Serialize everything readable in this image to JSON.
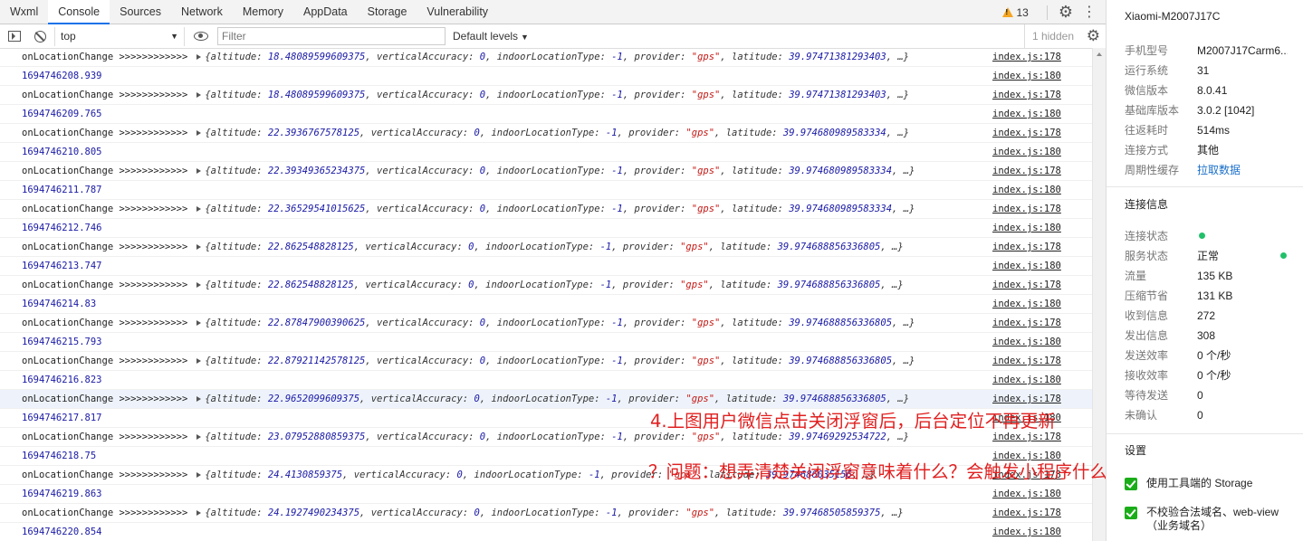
{
  "tabs": [
    "Wxml",
    "Console",
    "Sources",
    "Network",
    "Memory",
    "AppData",
    "Storage",
    "Vulnerability"
  ],
  "active_tab": "Console",
  "warnings_count": "13",
  "toolbar": {
    "context": "top",
    "filter_placeholder": "Filter",
    "levels": "Default levels",
    "hidden": "1 hidden"
  },
  "logs": [
    {
      "label": "onLocationChange >>>>>>>>>>>>",
      "altitude": "18.48089599609375",
      "latitude": "39.97471381293403",
      "src": "index.js:178",
      "ts": "1694746208.939",
      "ts_src": "index.js:180"
    },
    {
      "label": "onLocationChange >>>>>>>>>>>>",
      "altitude": "18.48089599609375",
      "latitude": "39.97471381293403",
      "src": "index.js:178",
      "ts": "1694746209.765",
      "ts_src": "index.js:180"
    },
    {
      "label": "onLocationChange >>>>>>>>>>>>",
      "altitude": "22.3936767578125",
      "latitude": "39.974680989583334",
      "src": "index.js:178",
      "ts": "1694746210.805",
      "ts_src": "index.js:180"
    },
    {
      "label": "onLocationChange >>>>>>>>>>>>",
      "altitude": "22.39349365234375",
      "latitude": "39.974680989583334",
      "src": "index.js:178",
      "ts": "1694746211.787",
      "ts_src": "index.js:180"
    },
    {
      "label": "onLocationChange >>>>>>>>>>>>",
      "altitude": "22.36529541015625",
      "latitude": "39.974680989583334",
      "src": "index.js:178",
      "ts": "1694746212.746",
      "ts_src": "index.js:180"
    },
    {
      "label": "onLocationChange >>>>>>>>>>>>",
      "altitude": "22.862548828125",
      "latitude": "39.974688856336805",
      "src": "index.js:178",
      "ts": "1694746213.747",
      "ts_src": "index.js:180"
    },
    {
      "label": "onLocationChange >>>>>>>>>>>>",
      "altitude": "22.862548828125",
      "latitude": "39.974688856336805",
      "src": "index.js:178",
      "ts": "1694746214.83",
      "ts_src": "index.js:180"
    },
    {
      "label": "onLocationChange >>>>>>>>>>>>",
      "altitude": "22.87847900390625",
      "latitude": "39.974688856336805",
      "src": "index.js:178",
      "ts": "1694746215.793",
      "ts_src": "index.js:180"
    },
    {
      "label": "onLocationChange >>>>>>>>>>>>",
      "altitude": "22.87921142578125",
      "latitude": "39.974688856336805",
      "src": "index.js:178",
      "ts": "1694746216.823",
      "ts_src": "index.js:180"
    },
    {
      "label": "onLocationChange >>>>>>>>>>>>",
      "altitude": "22.9652099609375",
      "latitude": "39.974688856336805",
      "src": "index.js:178",
      "ts": "1694746217.817",
      "ts_src": "index.js:180",
      "highlight": true
    },
    {
      "label": "onLocationChange >>>>>>>>>>>>",
      "altitude": "23.07952880859375",
      "latitude": "39.97469292534722",
      "src": "index.js:178",
      "ts": "1694746218.75",
      "ts_src": "index.js:180"
    },
    {
      "label": "onLocationChange >>>>>>>>>>>>",
      "altitude": "24.4130859375",
      "latitude": "39.974686035156",
      "src": "index.js:178",
      "ts": "1694746219.863",
      "ts_src": "index.js:180"
    },
    {
      "label": "onLocationChange >>>>>>>>>>>>",
      "altitude": "24.1927490234375",
      "latitude": "39.97468505859375",
      "src": "index.js:178",
      "ts": "1694746220.854",
      "ts_src": "index.js:180"
    }
  ],
  "obj_tail": {
    "vertical": "verticalAccuracy: ",
    "vertical_val": "0",
    "indoor": "indoorLocationType: ",
    "indoor_val": "-1",
    "provider": "provider: ",
    "provider_val": "\"gps\"",
    "altitude_key": "altitude: ",
    "latitude_key": "latitude: ",
    "ellipsis": "…}",
    "open": "{"
  },
  "annotations": {
    "line1": "4.上图用户微信点击关闭浮窗后，后台定位不再更新",
    "line2": "？问题：想弄清楚关闭浮窗意味着什么？会触发小程序什么函数么？"
  },
  "side": {
    "device": "Xiaomi-M2007J17C",
    "info": [
      {
        "k": "手机型号",
        "v": "M2007J17Carm6..."
      },
      {
        "k": "运行系统",
        "v": "31"
      },
      {
        "k": "微信版本",
        "v": "8.0.41"
      },
      {
        "k": "基础库版本",
        "v": "3.0.2 [1042]"
      },
      {
        "k": "往返耗时",
        "v": "514ms"
      },
      {
        "k": "连接方式",
        "v": "其他"
      },
      {
        "k": "周期性缓存",
        "v": "拉取数据"
      }
    ],
    "conn_title": "连接信息",
    "conn": [
      {
        "k": "连接状态",
        "v": ""
      },
      {
        "k": "服务状态",
        "v": "正常"
      },
      {
        "k": "流量",
        "v": "135 KB"
      },
      {
        "k": "压缩节省",
        "v": "131 KB"
      },
      {
        "k": "收到信息",
        "v": "272"
      },
      {
        "k": "发出信息",
        "v": "308"
      },
      {
        "k": "发送效率",
        "v": "0 个/秒"
      },
      {
        "k": "接收效率",
        "v": "0 个/秒"
      },
      {
        "k": "等待发送",
        "v": "0"
      },
      {
        "k": "未确认",
        "v": "0"
      }
    ],
    "settings_title": "设置",
    "settings": [
      "使用工具端的 Storage",
      "不校验合法域名、web-view（业务域名）"
    ],
    "status_color": "#23c06b",
    "link_color": "#1a6fc9",
    "checkbox_color": "#1aad19"
  }
}
